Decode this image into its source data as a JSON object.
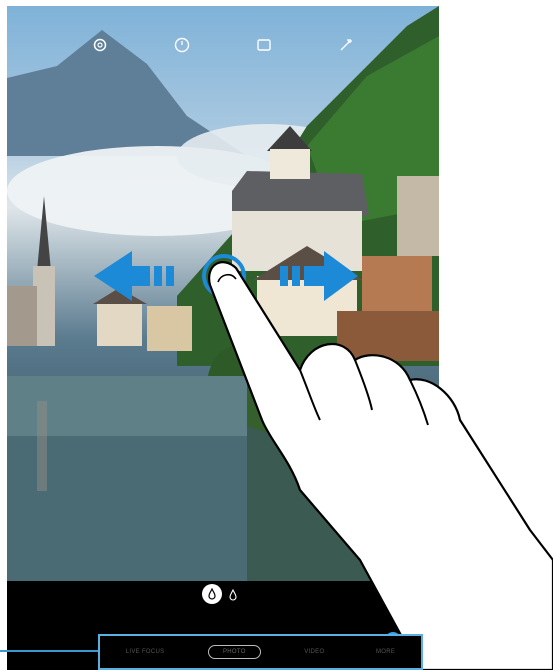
{
  "camera": {
    "top_icons": [
      {
        "name": "settings-icon"
      },
      {
        "name": "timer-icon"
      },
      {
        "name": "aspect-ratio-icon"
      },
      {
        "name": "filter-icon"
      }
    ],
    "bottom": {
      "filter_icons": [
        "beauty-filter-icon",
        "effects-filter-icon"
      ],
      "settings_fab_icon": "gear-icon"
    }
  },
  "modes": {
    "items": [
      {
        "label": "LIVE FOCUS",
        "active": false
      },
      {
        "label": "PHOTO",
        "active": true
      },
      {
        "label": "VIDEO",
        "active": false
      },
      {
        "label": "MORE",
        "active": false
      }
    ]
  },
  "gesture": {
    "type": "swipe-left-right",
    "accent": "#1d8ad8",
    "callout_color": "#3a9ad0"
  }
}
